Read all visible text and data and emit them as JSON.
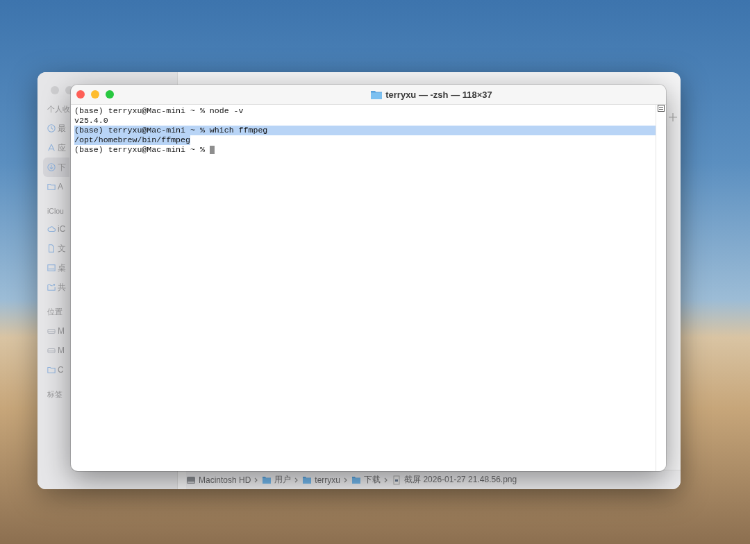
{
  "finder": {
    "sidebar": {
      "sections": [
        {
          "title": "个人收",
          "items": [
            {
              "label": "最",
              "kind": "clock",
              "selected": false
            },
            {
              "label": "应",
              "kind": "apps",
              "selected": false
            },
            {
              "label": "下",
              "kind": "download",
              "selected": true
            },
            {
              "label": "A",
              "kind": "folder",
              "selected": false
            }
          ]
        },
        {
          "title": "iClou",
          "items": [
            {
              "label": "iC",
              "kind": "cloud",
              "selected": false
            },
            {
              "label": "文",
              "kind": "document",
              "selected": false
            },
            {
              "label": "桌",
              "kind": "desktop",
              "selected": false
            },
            {
              "label": "共",
              "kind": "shared",
              "selected": false
            }
          ]
        },
        {
          "title": "位置",
          "items": [
            {
              "label": "M",
              "kind": "drive",
              "selected": false
            },
            {
              "label": "M",
              "kind": "drive",
              "selected": false
            },
            {
              "label": "C",
              "kind": "folder",
              "selected": false
            }
          ]
        },
        {
          "title": "标签"
        }
      ]
    },
    "path_bar": [
      {
        "label": "Macintosh HD",
        "kind": "disk"
      },
      {
        "label": "用户",
        "kind": "folder"
      },
      {
        "label": "terryxu",
        "kind": "folder"
      },
      {
        "label": "下载",
        "kind": "folder"
      },
      {
        "label": "截屏 2026-01-27 21.48.56.png",
        "kind": "file"
      }
    ]
  },
  "terminal": {
    "title": "terryxu — -zsh — 118×37",
    "lines": [
      {
        "text": "(base) terryxu@Mac-mini ~ % node -v",
        "selected": false,
        "cursor": false
      },
      {
        "text": "v25.4.0",
        "selected": false,
        "cursor": false
      },
      {
        "text": "(base) terryxu@Mac-mini ~ % which ffmpeg",
        "selected": true,
        "cursor": false
      },
      {
        "text": "/opt/homebrew/bin/ffmpeg",
        "selected": true,
        "cursor": false
      },
      {
        "text": "(base) terryxu@Mac-mini ~ % ",
        "selected": false,
        "cursor": true
      }
    ]
  }
}
